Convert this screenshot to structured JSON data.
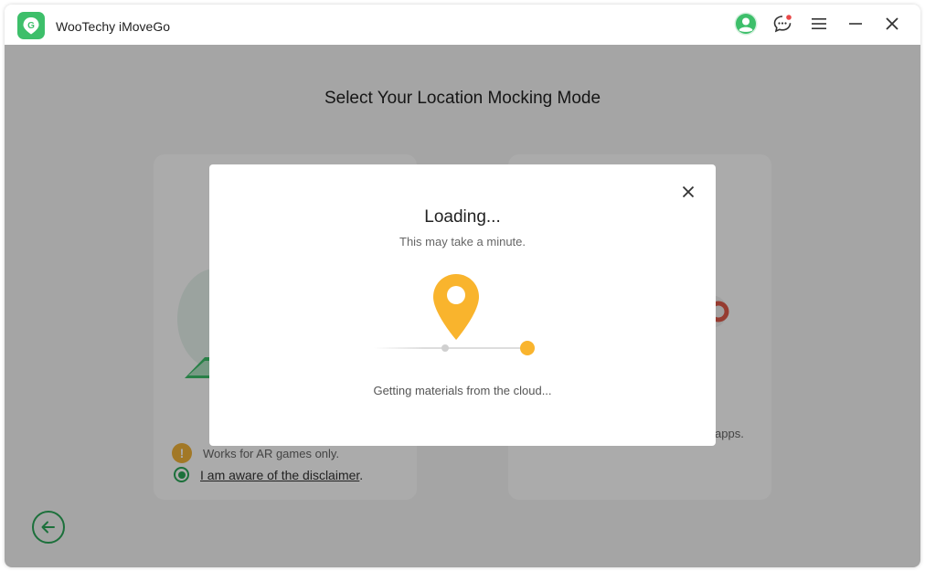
{
  "app": {
    "title": "WooTechy iMoveGo",
    "logo_letter": "G",
    "accent_color": "#3dbf6a"
  },
  "titlebar_icons": [
    "avatar-icon",
    "feedback-icon",
    "menu-icon",
    "minimize-icon",
    "close-icon"
  ],
  "page": {
    "title": "Select Your Location Mocking Mode",
    "left_card": {
      "warning_text": "Works for AR games only.",
      "aware_text": "I am aware of the disclaimer",
      "aware_suffix": "."
    },
    "right_card": {
      "partial_text": "apps."
    }
  },
  "modal": {
    "title": "Loading...",
    "subtitle": "This may take a minute.",
    "status": "Getting materials from the cloud...",
    "pin_color": "#f9b42d"
  }
}
